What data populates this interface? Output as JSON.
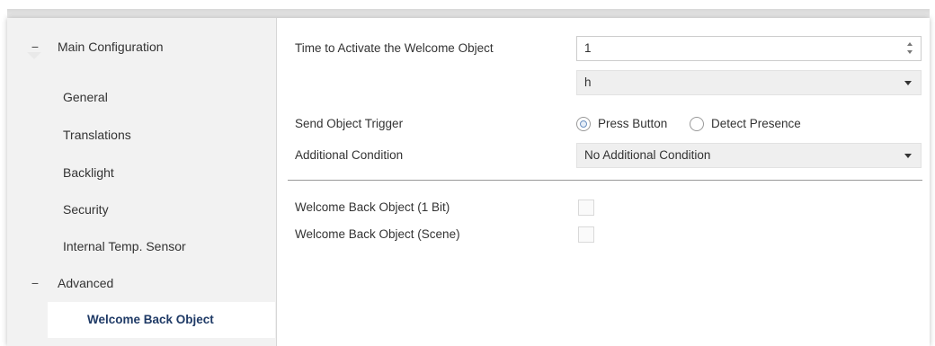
{
  "sidebar": {
    "main_group": {
      "collapse_symbol": "−",
      "label": "Main Configuration"
    },
    "items": [
      {
        "label": "General"
      },
      {
        "label": "Translations"
      },
      {
        "label": "Backlight"
      },
      {
        "label": "Security"
      },
      {
        "label": "Internal Temp. Sensor"
      }
    ],
    "advanced_group": {
      "collapse_symbol": "−",
      "label": "Advanced"
    },
    "active_item": {
      "label": "Welcome Back Object"
    }
  },
  "form": {
    "time_to_activate": {
      "label": "Time to Activate the Welcome Object",
      "value": "1"
    },
    "time_unit": {
      "value": "h"
    },
    "send_trigger": {
      "label": "Send Object Trigger",
      "options": [
        {
          "label": "Press Button",
          "selected": true
        },
        {
          "label": "Detect Presence",
          "selected": false
        }
      ]
    },
    "additional_condition": {
      "label": "Additional Condition",
      "value": "No Additional Condition"
    },
    "checkbox_1bit": {
      "label": "Welcome Back Object (1 Bit)",
      "checked": false
    },
    "checkbox_scene": {
      "label": "Welcome Back Object (Scene)",
      "checked": false
    }
  }
}
